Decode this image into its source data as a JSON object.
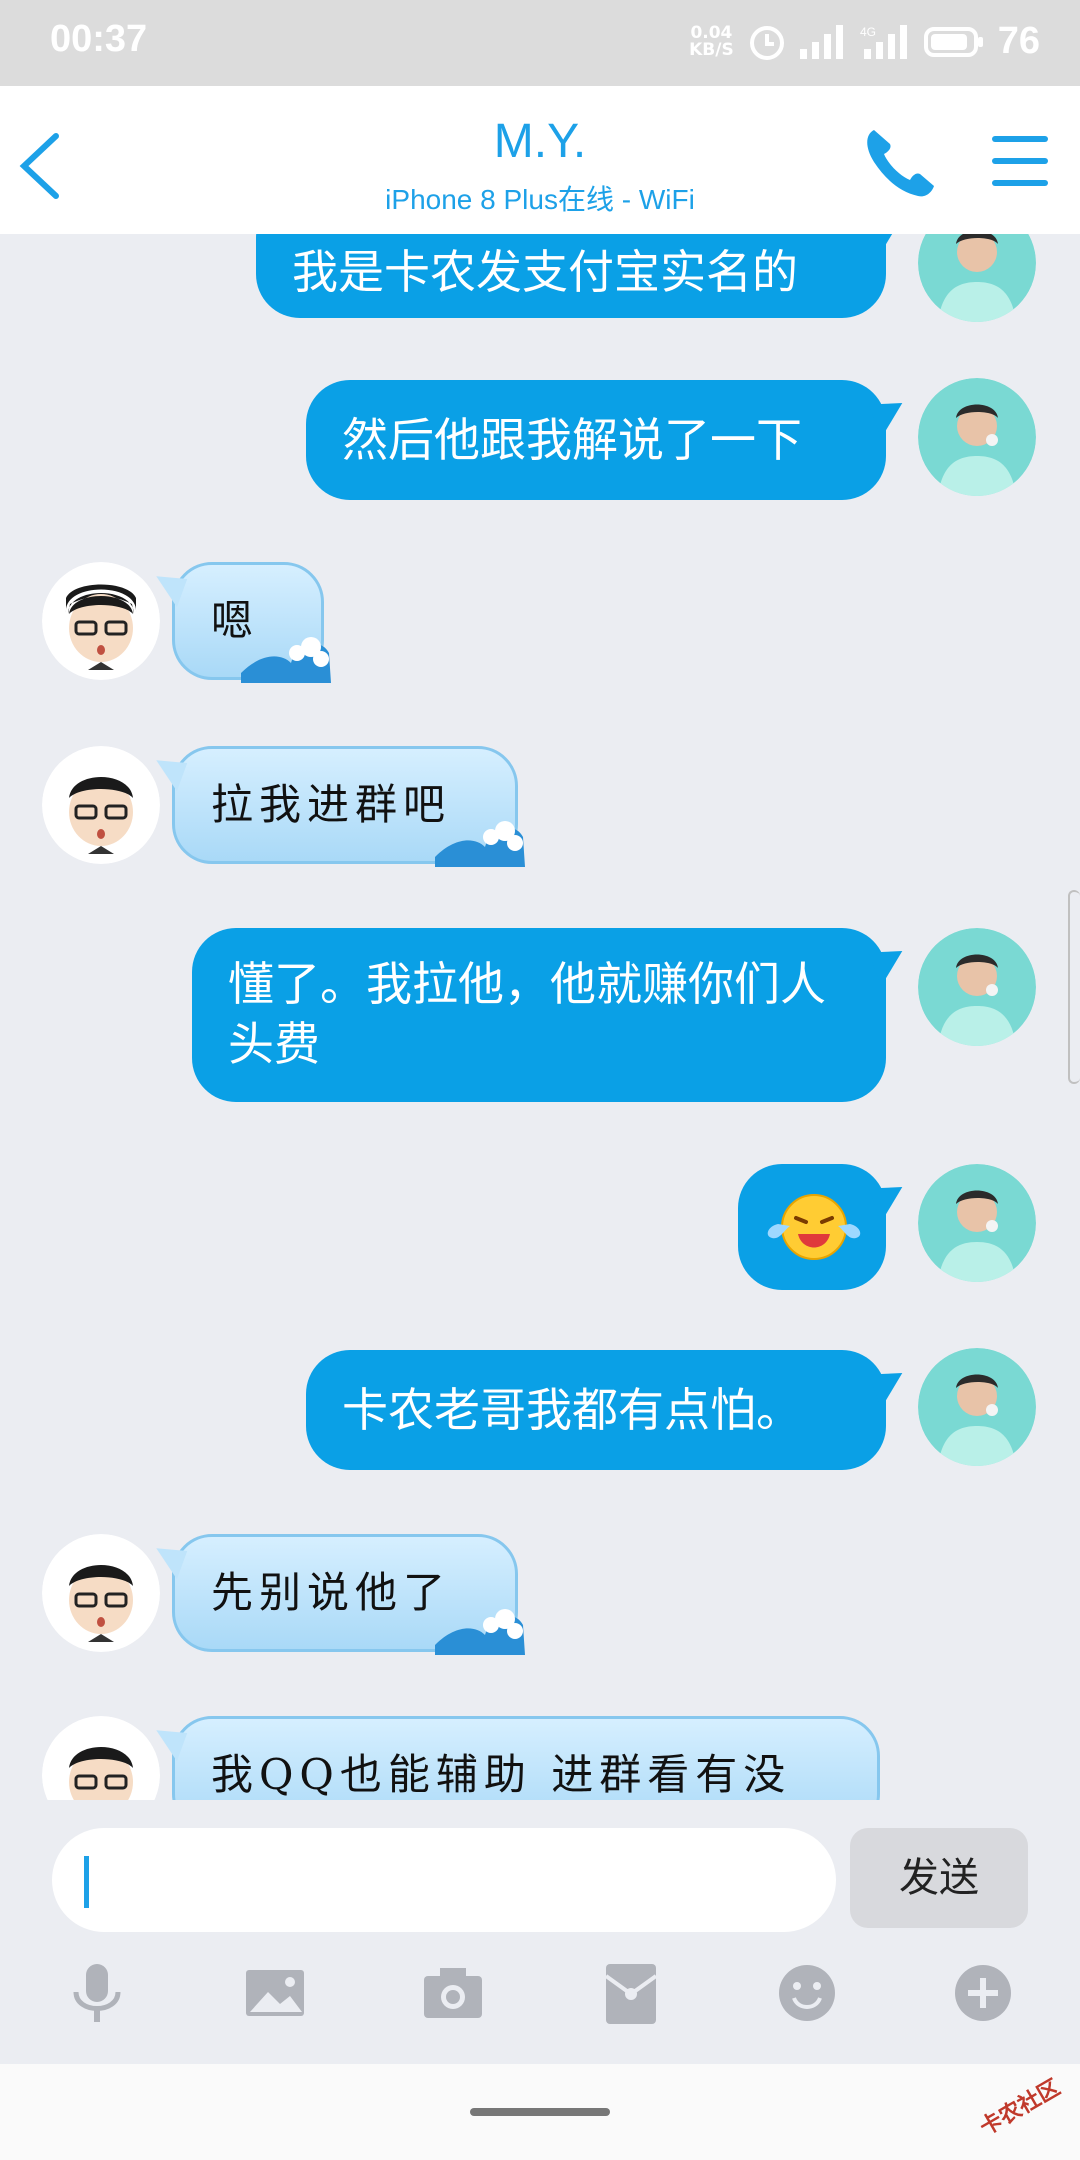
{
  "status": {
    "time": "00:37",
    "speed_top": "0.04",
    "speed_bottom": "KB/S",
    "network": "4G",
    "battery": "76"
  },
  "header": {
    "title": "M.Y.",
    "subtitle": "iPhone 8 Plus在线 - WiFi"
  },
  "messages": [
    {
      "from": "me",
      "text": "我是卡农发支付宝实名的"
    },
    {
      "from": "me",
      "text": "然后他跟我解说了一下"
    },
    {
      "from": "other",
      "text": "嗯"
    },
    {
      "from": "other",
      "text": "拉我进群吧"
    },
    {
      "from": "me",
      "text": "懂了。我拉他，他就赚你们人头费"
    },
    {
      "from": "me",
      "emoji": "laughing-crying-emoji"
    },
    {
      "from": "me",
      "text": "卡农老哥我都有点怕。"
    },
    {
      "from": "other",
      "text": "先别说他了"
    },
    {
      "from": "other",
      "text": "我QQ也能辅助  进群看有没"
    }
  ],
  "input": {
    "value": "",
    "send_label": "发送"
  },
  "tools": [
    "microphone-icon",
    "image-icon",
    "camera-icon",
    "red-packet-icon",
    "emoji-icon",
    "plus-icon"
  ],
  "watermark": "卡农社区",
  "colors": {
    "accent": "#1da1e8",
    "my_bubble": "#0aa0e6",
    "background": "#ebedf2"
  }
}
